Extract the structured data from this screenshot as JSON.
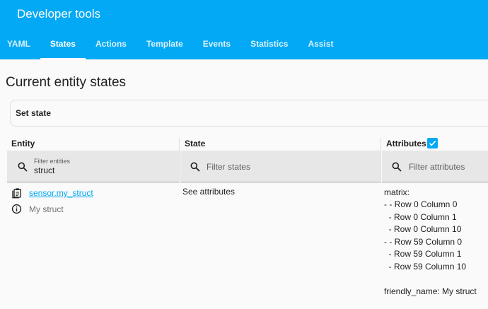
{
  "header": {
    "title": "Developer tools",
    "tabs": [
      "YAML",
      "States",
      "Actions",
      "Template",
      "Events",
      "Statistics",
      "Assist"
    ],
    "active_tab": "States"
  },
  "main": {
    "page_title": "Current entity states",
    "set_state_label": "Set state",
    "columns": {
      "entity": "Entity",
      "state": "State",
      "attributes": "Attributes",
      "attributes_checked": true
    },
    "filters": {
      "entity_label": "Filter entities",
      "entity_value": "struct",
      "state_placeholder": "Filter states",
      "attributes_placeholder": "Filter attributes"
    },
    "row": {
      "entity_id": "sensor.my_struct",
      "friendly_name": "My struct",
      "state": "See attributes",
      "attributes": [
        "matrix:",
        "- - Row 0 Column 0",
        "  - Row 0 Column 1",
        "  - Row 0 Column 10",
        "- - Row 59 Column 0",
        "  - Row 59 Column 1",
        "  - Row 59 Column 10",
        "",
        "friendly_name: My struct"
      ]
    }
  },
  "colors": {
    "primary": "#03a9f4",
    "background": "#fafafa",
    "filter_background": "#e7e7e7",
    "secondary_text": "#727272"
  }
}
